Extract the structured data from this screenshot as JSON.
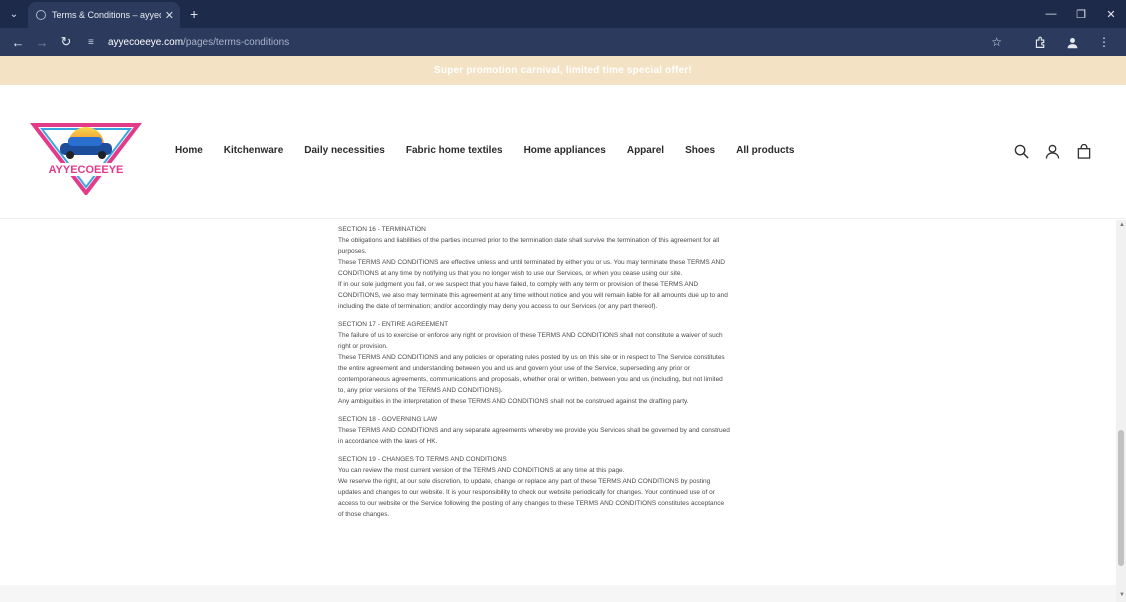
{
  "browser": {
    "tab_title": "Terms & Conditions – ayyecoee",
    "url_host": "ayyecoeeye.com",
    "url_path": "/pages/terms-conditions"
  },
  "promo": {
    "text": "Super promotion carnival, limited time special offer!"
  },
  "header": {
    "logo_text": "AYYECOEEYE",
    "nav": [
      "Home",
      "Kitchenware",
      "Daily necessities",
      "Fabric home textiles",
      "Home appliances",
      "Apparel",
      "Shoes",
      "All products"
    ]
  },
  "sections": [
    {
      "lines": [
        "SECTION 16 - TERMINATION",
        "The obligations and liabilities of the parties incurred prior to the termination date shall survive the termination of this agreement for all",
        "purposes.",
        "These TERMS AND CONDITIONS are effective unless and until terminated by either you or us. You may terminate these TERMS AND",
        "CONDITIONS at any time by notifying us that you no longer wish to use our Services, or when you cease using our site.",
        "If in our sole judgment you fail, or we suspect that you have failed, to comply with any term or provision of these TERMS AND",
        "CONDITIONS, we also may terminate this agreement at any time without notice and you will remain liable for all amounts due up to and",
        "including the date of termination; and/or accordingly may deny you access to our Services (or any part thereof)."
      ]
    },
    {
      "lines": [
        "SECTION 17 - ENTIRE AGREEMENT",
        "The failure of us to exercise or enforce any right or provision of these TERMS AND CONDITIONS shall not constitute a waiver of such",
        "right or provision.",
        "These TERMS AND CONDITIONS and any policies or operating rules posted by us on this site or in respect to The Service constitutes",
        "the entire agreement and understanding between you and us and govern your use of the Service, superseding any prior or",
        "contemporaneous agreements, communications and proposals, whether oral or written, between you and us (including, but not limited",
        "to, any prior versions of the TERMS AND CONDITIONS).",
        "Any ambiguities in the interpretation of these TERMS AND CONDITIONS shall not be construed against the drafting party."
      ]
    },
    {
      "lines": [
        "SECTION 18 - GOVERNING LAW",
        "These TERMS AND CONDITIONS and any separate agreements whereby we provide you Services shall be governed by and construed",
        "in accordance with the laws of HK."
      ]
    },
    {
      "lines": [
        "SECTION 19 - CHANGES TO TERMS AND CONDITIONS",
        "You can review the most current version of the TERMS AND CONDITIONS at any time at this page.",
        "We reserve the right, at our sole discretion, to update, change or replace any part of these TERMS AND CONDITIONS by posting",
        "updates and changes to our website. It is your responsibility to check our website periodically for changes. Your continued use of or",
        "access to our website or the Service following the posting of any changes to these TERMS AND CONDITIONS constitutes acceptance",
        "of those changes."
      ]
    }
  ]
}
